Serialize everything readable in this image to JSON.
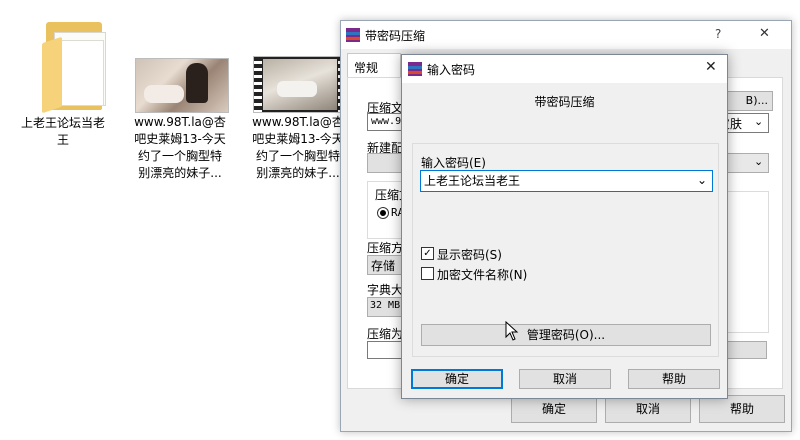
{
  "desktop": {
    "items": [
      {
        "label_lines": [
          "上老王论坛当老",
          "王"
        ]
      },
      {
        "label_lines": [
          "www.98T.la@杏",
          "吧史莱姆13-今天",
          "约了一个胸型特",
          "别漂亮的妹子..."
        ]
      },
      {
        "label_lines": [
          "www.98T.la@杏",
          "吧史莱姆13-今天",
          "约了一个胸型特",
          "别漂亮的妹子..."
        ]
      }
    ]
  },
  "back_dialog": {
    "title": "带密码压缩",
    "help_glyph": "?",
    "close_glyph": "✕",
    "tab_general": "常规",
    "label_archive": "压缩文",
    "archive_value": "www.98",
    "browse_suffix": "B)...",
    "profile_suffix": "皮肤",
    "label_new": "新建配",
    "group_format": "压缩文",
    "radio_label": "RA",
    "label_method": "压缩方",
    "method_value": "存储",
    "label_dict": "字典大",
    "dict_value": "32 MB",
    "label_split": "压缩为",
    "ok": "确定",
    "cancel": "取消",
    "help": "帮助"
  },
  "password_dialog": {
    "title": "输入密码",
    "close_glyph": "✕",
    "heading": "带密码压缩",
    "label_password": "输入密码(E)",
    "password_value": "上老王论坛当老王",
    "show_password": "显示密码(S)",
    "show_password_checked": true,
    "encrypt_names": "加密文件名称(N)",
    "encrypt_names_checked": false,
    "manage_button": "管理密码(O)...",
    "ok": "确定",
    "cancel": "取消",
    "help": "帮助"
  }
}
